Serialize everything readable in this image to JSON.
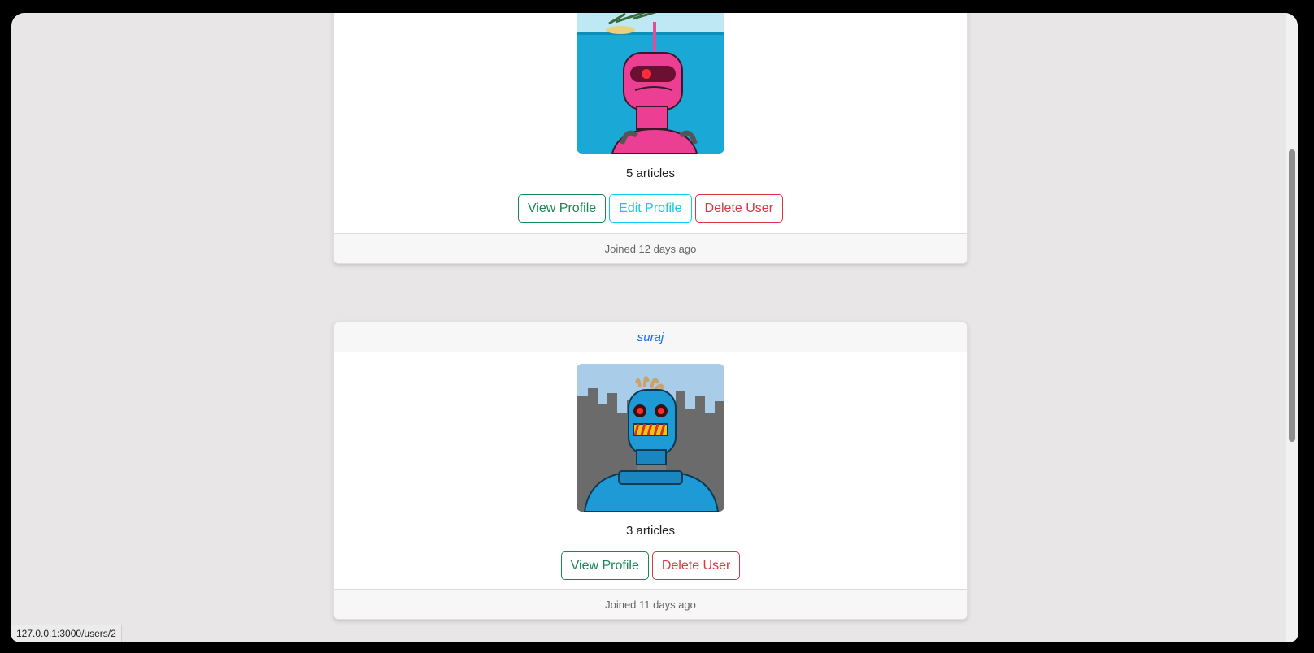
{
  "cards": [
    {
      "username": "",
      "articles": "5 articles",
      "buttons": {
        "view": "View Profile",
        "edit": "Edit Profile",
        "delete": "Delete User"
      },
      "joined": "Joined 12 days ago",
      "avatar": {
        "icon": "pink-robot-avatar",
        "bg": "#1aa9d6"
      }
    },
    {
      "username": "suraj",
      "articles": "3 articles",
      "buttons": {
        "view": "View Profile",
        "delete": "Delete User"
      },
      "joined": "Joined 11 days ago",
      "avatar": {
        "icon": "blue-robot-avatar",
        "bg": "#6b6b6b"
      }
    }
  ],
  "status_bar": {
    "url": "127.0.0.1:3000/users/2"
  },
  "colors": {
    "success": "#198754",
    "info": "#0dcaf0",
    "danger": "#dc3545",
    "link": "#1a6fe0"
  }
}
